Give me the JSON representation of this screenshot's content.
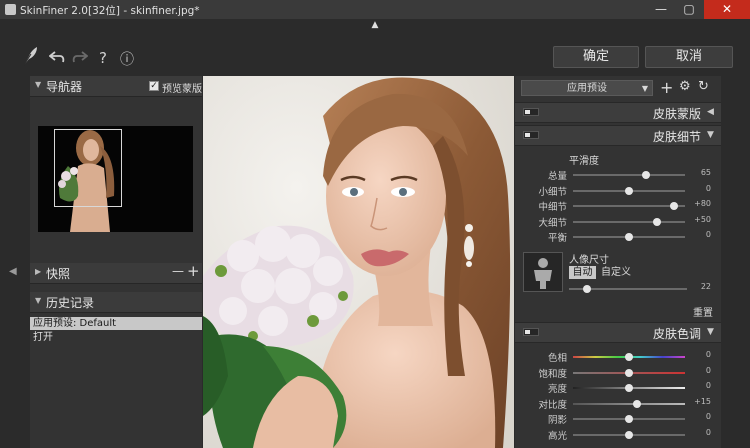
{
  "window": {
    "title": "SkinFiner 2.0[32位] - skinfiner.jpg*",
    "minimize": "—",
    "maximize": "▢",
    "close": "✕"
  },
  "toolbar": {
    "icons": [
      "feather-icon",
      "undo-icon",
      "redo-icon",
      "help-icon",
      "info-icon"
    ],
    "help_glyph": "?",
    "info_glyph": "ⓘ",
    "ok_label": "确定",
    "cancel_label": "取消"
  },
  "navigator": {
    "title": "导航器",
    "preview_checkbox_label": "预览蒙版",
    "preview_checked": true
  },
  "snapshot": {
    "title": "快照",
    "remove": "—",
    "add": "+"
  },
  "history": {
    "title": "历史记录",
    "items": [
      "应用预设: Default",
      "打开"
    ]
  },
  "presets": {
    "selected": "应用预设"
  },
  "skin_mask": {
    "title": "皮肤蒙版"
  },
  "skin_detail": {
    "title": "皮肤细节",
    "smoothness_label": "平滑度",
    "sliders": [
      {
        "label": "总量",
        "value": "65",
        "position": 65
      },
      {
        "label": "小细节",
        "value": "0",
        "position": 50
      },
      {
        "label": "中细节",
        "value": "+80",
        "position": 90
      },
      {
        "label": "大细节",
        "value": "+50",
        "position": 75
      },
      {
        "label": "平衡",
        "value": "0",
        "position": 50
      }
    ],
    "portrait_size_label": "人像尺寸",
    "auto_label": "自动",
    "custom_label": "自定义",
    "size_value": "22",
    "size_position": 15,
    "reset_label": "重置"
  },
  "skin_tone": {
    "title": "皮肤色调",
    "sliders": [
      {
        "label": "色相",
        "value": "0",
        "position": 50
      },
      {
        "label": "饱和度",
        "value": "0",
        "position": 50
      },
      {
        "label": "亮度",
        "value": "0",
        "position": 50
      },
      {
        "label": "对比度",
        "value": "+15",
        "position": 57
      },
      {
        "label": "阴影",
        "value": "0",
        "position": 50
      },
      {
        "label": "高光",
        "value": "0",
        "position": 50
      }
    ]
  },
  "colors": {
    "accent": "#c42b1c",
    "panel": "#333333",
    "background": "#2b2b2b"
  }
}
